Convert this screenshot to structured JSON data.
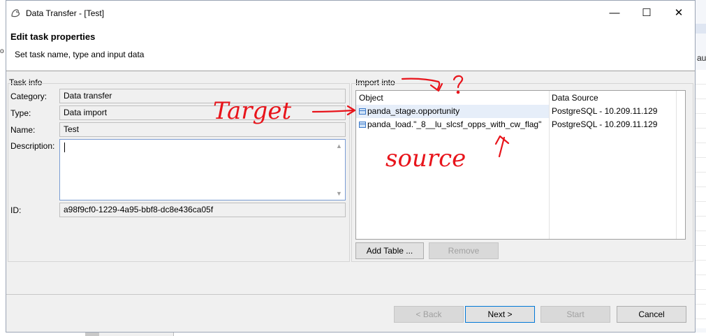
{
  "window": {
    "title": "Data Transfer - [Test]",
    "minimize_glyph": "—",
    "maximize_glyph": "☐",
    "close_glyph": "✕"
  },
  "header": {
    "title": "Edit task properties",
    "subtitle": "Set task name, type and input data"
  },
  "task_info": {
    "group_label": "Task info",
    "category_label": "Category:",
    "category_value": "Data transfer",
    "type_label": "Type:",
    "type_value": "Data import",
    "name_label": "Name:",
    "name_value": "Test",
    "description_label": "Description:",
    "description_value": "",
    "id_label": "ID:",
    "id_value": "a98f9cf0-1229-4a95-bbf8-dc8e436ca05f"
  },
  "import_into": {
    "group_label": "Import into",
    "columns": [
      "Object",
      "Data Source"
    ],
    "rows": [
      {
        "object": "panda_stage.opportunity",
        "data_source": "PostgreSQL - 10.209.11.129",
        "selected": true
      },
      {
        "object": "panda_load.\"_8__lu_slcsf_opps_with_cw_flag\"",
        "data_source": "PostgreSQL - 10.209.11.129",
        "selected": false
      }
    ],
    "add_table_label": "Add Table ...",
    "remove_label": "Remove"
  },
  "footer": {
    "back_label": "< Back",
    "next_label": "Next >",
    "start_label": "Start",
    "cancel_label": "Cancel"
  },
  "annotations": {
    "target_text": "Target",
    "source_text": "source",
    "question_mark": "?",
    "ink_color": "#e8141b"
  },
  "background": {
    "right_fragment": "aul",
    "left_fragment": "o"
  }
}
